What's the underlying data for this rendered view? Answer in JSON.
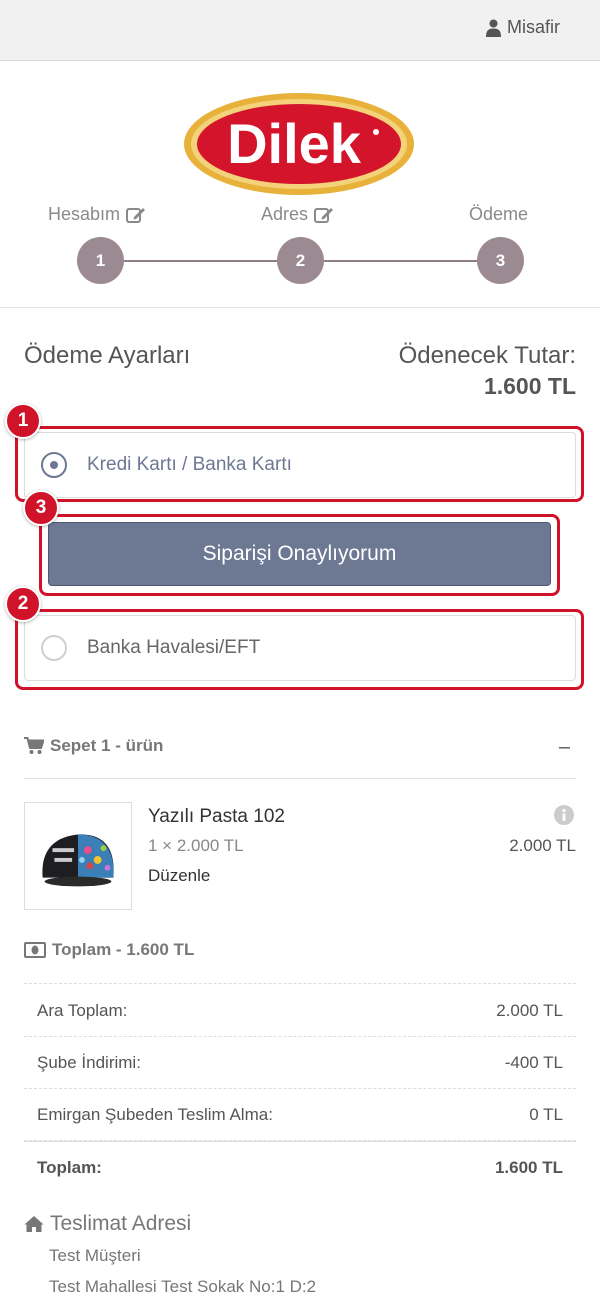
{
  "header": {
    "user_label": "Misafir"
  },
  "logo": {
    "text": "Dilek"
  },
  "steps": [
    {
      "label": "Hesabım",
      "number": "1"
    },
    {
      "label": "Adres",
      "number": "2"
    },
    {
      "label": "Ödeme",
      "number": "3"
    }
  ],
  "payment": {
    "title": "Ödeme Ayarları",
    "amount_label": "Ödenecek Tutar:",
    "amount_value": "1.600 TL",
    "options": [
      {
        "label": "Kredi Kartı / Banka Kartı",
        "selected": true
      },
      {
        "label": "Banka Havalesi/EFT",
        "selected": false
      }
    ],
    "confirm_label": "Siparişi Onaylıyorum"
  },
  "annotations": [
    "1",
    "2",
    "3"
  ],
  "cart": {
    "header": "Sepet 1 - ürün",
    "collapse_symbol": "–",
    "item": {
      "name": "Yazılı Pasta 102",
      "qty_price": "1 × 2.000 TL",
      "edit_label": "Düzenle",
      "total": "2.000 TL"
    }
  },
  "summary": {
    "header": "Toplam - 1.600 TL",
    "rows": [
      {
        "label": "Ara Toplam:",
        "value": "2.000 TL"
      },
      {
        "label": "Şube İndirimi:",
        "value": "-400 TL"
      },
      {
        "label": "Emirgan Şubeden Teslim Alma:",
        "value": "0 TL"
      }
    ],
    "total": {
      "label": "Toplam:",
      "value": "1.600 TL"
    }
  },
  "delivery": {
    "header": "Teslimat Adresi",
    "lines": [
      "Test Müşteri",
      "Test Mahallesi Test Sokak No:1 D:2"
    ]
  },
  "colors": {
    "primary_button": "#6d7893",
    "step_circle": "#9b8a92",
    "annotation_red": "#d1132a",
    "logo_red": "#d3142b",
    "logo_gold": "#e8b23a"
  }
}
